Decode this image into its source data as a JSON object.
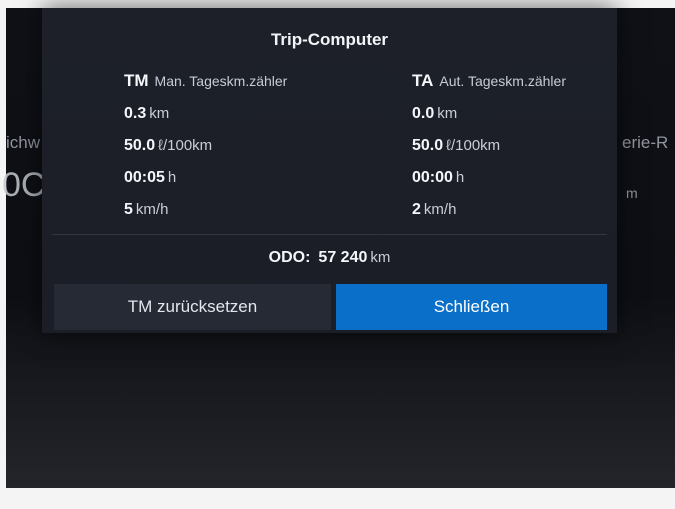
{
  "background": {
    "left_text_1": "ichw",
    "left_text_2": "0C",
    "right_text_1": "erie-R",
    "right_text_2": "m"
  },
  "dialog": {
    "title": "Trip-Computer",
    "tm": {
      "code": "TM",
      "description": "Man. Tageskm.zähler",
      "distance": "0.3",
      "distance_unit": "km",
      "consumption": "50.0",
      "consumption_unit": "ℓ/100km",
      "time": "00:05",
      "time_unit": "h",
      "speed": "5",
      "speed_unit": "km/h"
    },
    "ta": {
      "code": "TA",
      "description": "Aut. Tageskm.zähler",
      "distance": "0.0",
      "distance_unit": "km",
      "consumption": "50.0",
      "consumption_unit": "ℓ/100km",
      "time": "00:00",
      "time_unit": "h",
      "speed": "2",
      "speed_unit": "km/h"
    },
    "odometer": {
      "label": "ODO:",
      "value": "57 240",
      "unit": "km"
    },
    "buttons": {
      "reset_label": "TM zurücksetzen",
      "close_label": "Schließen"
    }
  },
  "colors": {
    "dialog_background": "#1c1f28",
    "primary_button": "#0a6fc8",
    "secondary_button": "#262a35"
  }
}
